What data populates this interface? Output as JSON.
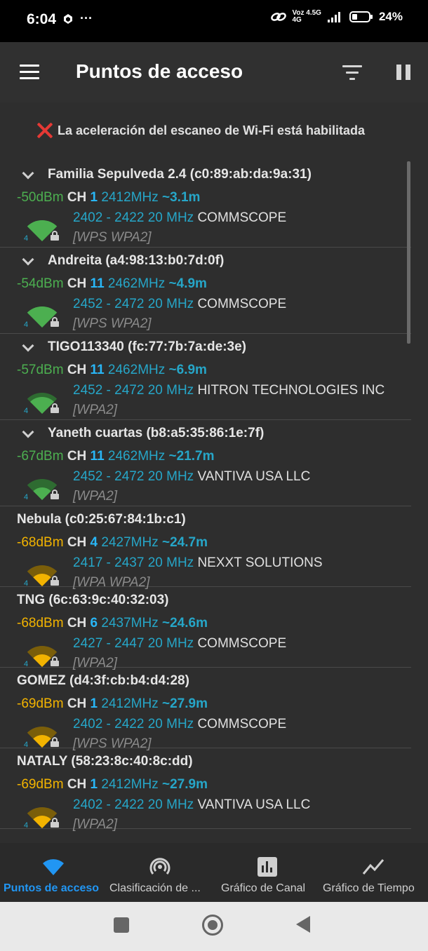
{
  "status_bar": {
    "time": "6:04",
    "ellipsis": "···",
    "network_top": "Voz 4.5G",
    "network_bottom": "4G",
    "battery": "24%"
  },
  "app_bar": {
    "title": "Puntos de acceso"
  },
  "warning": {
    "text": "La aceleración del escaneo de Wi-Fi está habilitada"
  },
  "access_points": [
    {
      "ssid": "Familia Sepulveda 2.4 (c0:89:ab:da:9a:31)",
      "expandable": true,
      "dbm": "-50dBm",
      "ch_label": "CH",
      "channel": "1",
      "freq": "2412MHz",
      "distance": "~3.1m",
      "range": "2402 - 2422 20 MHz",
      "vendor": "COMMSCOPE",
      "security": "[WPS WPA2]",
      "bars": 4,
      "signal_color": "#4caf50",
      "signal_level": 4
    },
    {
      "ssid": "Andreita (a4:98:13:b0:7d:0f)",
      "expandable": true,
      "dbm": "-54dBm",
      "ch_label": "CH",
      "channel": "11",
      "freq": "2462MHz",
      "distance": "~4.9m",
      "range": "2452 - 2472 20 MHz",
      "vendor": "COMMSCOPE",
      "security": "[WPS WPA2]",
      "bars": 4,
      "signal_color": "#4caf50",
      "signal_level": 4
    },
    {
      "ssid": "TIGO113340 (fc:77:7b:7a:de:3e)",
      "expandable": true,
      "dbm": "-57dBm",
      "ch_label": "CH",
      "channel": "11",
      "freq": "2462MHz",
      "distance": "~6.9m",
      "range": "2452 - 2472 20 MHz",
      "vendor": "HITRON TECHNOLOGIES INC",
      "security": "[WPA2]",
      "bars": 4,
      "signal_color": "#4caf50",
      "signal_level": 3
    },
    {
      "ssid": "Yaneth cuartas (b8:a5:35:86:1e:7f)",
      "expandable": true,
      "dbm": "-67dBm",
      "ch_label": "CH",
      "channel": "11",
      "freq": "2462MHz",
      "distance": "~21.7m",
      "range": "2452 - 2472 20 MHz",
      "vendor": "VANTIVA USA LLC",
      "security": "[WPA2]",
      "bars": 4,
      "signal_color": "#4caf50",
      "signal_level": 2
    },
    {
      "ssid": "Nebula (c0:25:67:84:1b:c1)",
      "expandable": false,
      "dbm": "-68dBm",
      "ch_label": "CH",
      "channel": "4",
      "freq": "2427MHz",
      "distance": "~24.7m",
      "range": "2417 - 2437 20 MHz",
      "vendor": "NEXXT SOLUTIONS",
      "security": "[WPA WPA2]",
      "bars": 4,
      "signal_color": "#f2b300",
      "signal_level": 2
    },
    {
      "ssid": "TNG (6c:63:9c:40:32:03)",
      "expandable": false,
      "dbm": "-68dBm",
      "ch_label": "CH",
      "channel": "6",
      "freq": "2437MHz",
      "distance": "~24.6m",
      "range": "2427 - 2447 20 MHz",
      "vendor": "COMMSCOPE",
      "security": "[WPA2]",
      "bars": 4,
      "signal_color": "#f2b300",
      "signal_level": 2
    },
    {
      "ssid": "GOMEZ (d4:3f:cb:b4:d4:28)",
      "expandable": false,
      "dbm": "-69dBm",
      "ch_label": "CH",
      "channel": "1",
      "freq": "2412MHz",
      "distance": "~27.9m",
      "range": "2402 - 2422 20 MHz",
      "vendor": "COMMSCOPE",
      "security": "[WPS WPA2]",
      "bars": 4,
      "signal_color": "#f2b300",
      "signal_level": 2
    },
    {
      "ssid": "NATALY (58:23:8c:40:8c:dd)",
      "expandable": false,
      "dbm": "-69dBm",
      "ch_label": "CH",
      "channel": "1",
      "freq": "2412MHz",
      "distance": "~27.9m",
      "range": "2402 - 2422 20 MHz",
      "vendor": "VANTIVA USA LLC",
      "security": "[WPA2]",
      "bars": 4,
      "signal_color": "#f2b300",
      "signal_level": 2
    }
  ],
  "bottom_nav": [
    {
      "label": "Puntos de acceso",
      "icon": "wifi-icon",
      "active": true
    },
    {
      "label": "Clasificación de ...",
      "icon": "broadcast-icon",
      "active": false
    },
    {
      "label": "Gráfico de Canal",
      "icon": "bar-chart-icon",
      "active": false
    },
    {
      "label": "Gráfico de Tiempo",
      "icon": "line-chart-icon",
      "active": false
    }
  ],
  "colors": {
    "accent": "#2196f3",
    "good_signal": "#4caf50",
    "fair_signal": "#f2b300",
    "cyan_text": "#26a6c8",
    "warning_red": "#e53935"
  }
}
